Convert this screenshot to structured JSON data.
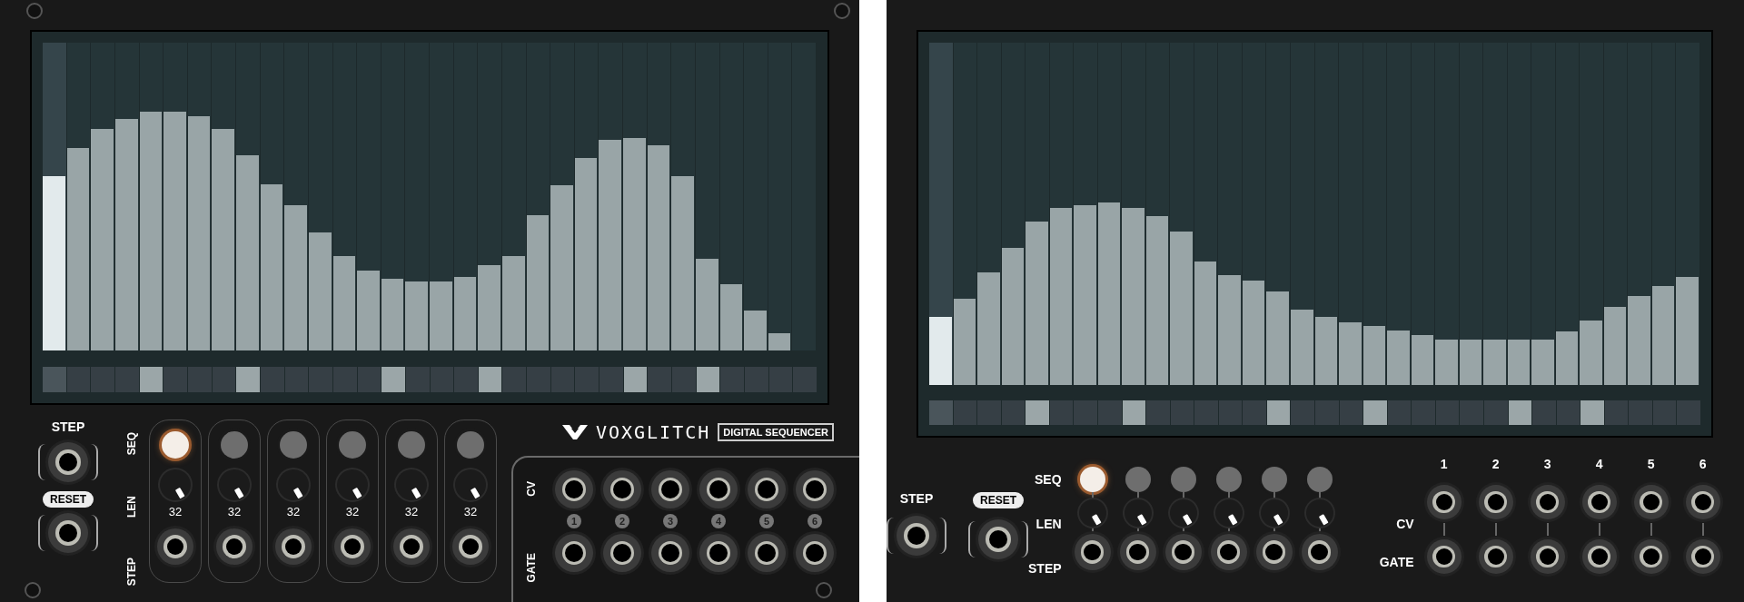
{
  "modules": [
    {
      "kind": "classic",
      "brand": {
        "name": "VOXGLITCH",
        "subtitle": "DIGITAL SEQUENCER"
      },
      "steps": [
        {
          "level": 0.567,
          "gate": false,
          "active": true
        },
        {
          "level": 0.657,
          "gate": false,
          "active": false
        },
        {
          "level": 0.72,
          "gate": false,
          "active": false
        },
        {
          "level": 0.751,
          "gate": false,
          "active": false
        },
        {
          "level": 0.777,
          "gate": true,
          "active": false
        },
        {
          "level": 0.777,
          "gate": false,
          "active": false
        },
        {
          "level": 0.762,
          "gate": false,
          "active": false
        },
        {
          "level": 0.72,
          "gate": false,
          "active": false
        },
        {
          "level": 0.635,
          "gate": true,
          "active": false
        },
        {
          "level": 0.54,
          "gate": false,
          "active": false
        },
        {
          "level": 0.471,
          "gate": false,
          "active": false
        },
        {
          "level": 0.383,
          "gate": false,
          "active": false
        },
        {
          "level": 0.308,
          "gate": false,
          "active": false
        },
        {
          "level": 0.26,
          "gate": false,
          "active": false
        },
        {
          "level": 0.234,
          "gate": true,
          "active": false
        },
        {
          "level": 0.223,
          "gate": false,
          "active": false
        },
        {
          "level": 0.223,
          "gate": false,
          "active": false
        },
        {
          "level": 0.239,
          "gate": false,
          "active": false
        },
        {
          "level": 0.276,
          "gate": true,
          "active": false
        },
        {
          "level": 0.308,
          "gate": false,
          "active": false
        },
        {
          "level": 0.44,
          "gate": false,
          "active": false
        },
        {
          "level": 0.536,
          "gate": false,
          "active": false
        },
        {
          "level": 0.624,
          "gate": false,
          "active": false
        },
        {
          "level": 0.683,
          "gate": false,
          "active": false
        },
        {
          "level": 0.689,
          "gate": true,
          "active": false
        },
        {
          "level": 0.667,
          "gate": false,
          "active": false
        },
        {
          "level": 0.567,
          "gate": false,
          "active": false
        },
        {
          "level": 0.298,
          "gate": true,
          "active": false
        },
        {
          "level": 0.214,
          "gate": false,
          "active": false
        },
        {
          "level": 0.129,
          "gate": false,
          "active": false
        },
        {
          "level": 0.055,
          "gate": false,
          "active": false
        },
        {
          "level": 0,
          "gate": false,
          "active": false
        }
      ],
      "inputs": {
        "step_label": "STEP",
        "reset_label": "RESET"
      },
      "row_labels": [
        "SEQ",
        "LEN",
        "STEP"
      ],
      "channels": [
        {
          "selected": true,
          "length": "32"
        },
        {
          "selected": false,
          "length": "32"
        },
        {
          "selected": false,
          "length": "32"
        },
        {
          "selected": false,
          "length": "32"
        },
        {
          "selected": false,
          "length": "32"
        },
        {
          "selected": false,
          "length": "32"
        }
      ],
      "outputs": {
        "row_labels": [
          "CV",
          "GATE"
        ],
        "numbers": [
          "1",
          "2",
          "3",
          "4",
          "5",
          "6"
        ]
      }
    },
    {
      "kind": "modern",
      "steps": [
        {
          "level": 0.198,
          "gate": false,
          "active": true
        },
        {
          "level": 0.253,
          "gate": false,
          "active": false
        },
        {
          "level": 0.328,
          "gate": false,
          "active": false
        },
        {
          "level": 0.4,
          "gate": false,
          "active": false
        },
        {
          "level": 0.477,
          "gate": true,
          "active": false
        },
        {
          "level": 0.516,
          "gate": false,
          "active": false
        },
        {
          "level": 0.526,
          "gate": false,
          "active": false
        },
        {
          "level": 0.532,
          "gate": false,
          "active": false
        },
        {
          "level": 0.516,
          "gate": true,
          "active": false
        },
        {
          "level": 0.494,
          "gate": false,
          "active": false
        },
        {
          "level": 0.448,
          "gate": false,
          "active": false
        },
        {
          "level": 0.36,
          "gate": false,
          "active": false
        },
        {
          "level": 0.321,
          "gate": false,
          "active": false
        },
        {
          "level": 0.305,
          "gate": false,
          "active": false
        },
        {
          "level": 0.273,
          "gate": true,
          "active": false
        },
        {
          "level": 0.221,
          "gate": false,
          "active": false
        },
        {
          "level": 0.198,
          "gate": false,
          "active": false
        },
        {
          "level": 0.182,
          "gate": false,
          "active": false
        },
        {
          "level": 0.172,
          "gate": true,
          "active": false
        },
        {
          "level": 0.159,
          "gate": false,
          "active": false
        },
        {
          "level": 0.146,
          "gate": false,
          "active": false
        },
        {
          "level": 0.133,
          "gate": false,
          "active": false
        },
        {
          "level": 0.133,
          "gate": false,
          "active": false
        },
        {
          "level": 0.133,
          "gate": false,
          "active": false
        },
        {
          "level": 0.133,
          "gate": true,
          "active": false
        },
        {
          "level": 0.133,
          "gate": false,
          "active": false
        },
        {
          "level": 0.156,
          "gate": false,
          "active": false
        },
        {
          "level": 0.188,
          "gate": true,
          "active": false
        },
        {
          "level": 0.227,
          "gate": false,
          "active": false
        },
        {
          "level": 0.26,
          "gate": false,
          "active": false
        },
        {
          "level": 0.29,
          "gate": false,
          "active": false
        },
        {
          "level": 0.315,
          "gate": false,
          "active": false
        }
      ],
      "inputs": {
        "step_label": "STEP",
        "reset_label": "RESET"
      },
      "row_labels": [
        "SEQ",
        "LEN",
        "STEP"
      ],
      "channels": [
        {
          "selected": true
        },
        {
          "selected": false
        },
        {
          "selected": false
        },
        {
          "selected": false
        },
        {
          "selected": false
        },
        {
          "selected": false
        }
      ],
      "outputs": {
        "row_labels": [
          "CV",
          "GATE"
        ],
        "numbers": [
          "1",
          "2",
          "3",
          "4",
          "5",
          "6"
        ]
      }
    }
  ]
}
